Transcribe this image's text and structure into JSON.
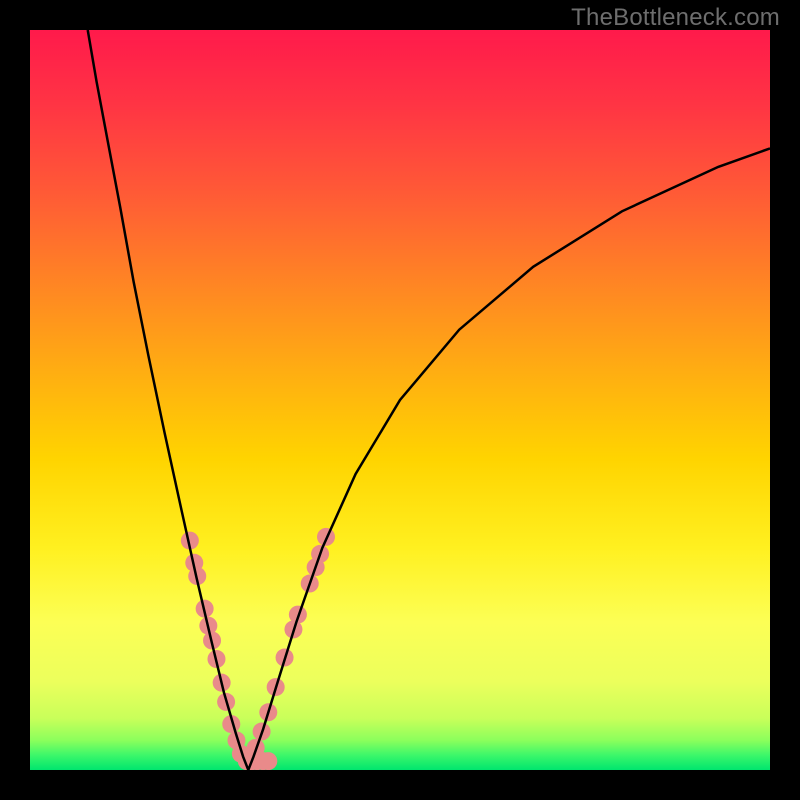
{
  "watermark": "TheBottleneck.com",
  "chart_data": {
    "type": "line",
    "title": "",
    "xlabel": "",
    "ylabel": "",
    "x_range": [
      0,
      1
    ],
    "y_range": [
      0,
      1
    ],
    "background_gradient": {
      "top_color": "#ff1a4b",
      "mid_colors": [
        "#ff6e2a",
        "#ffb200",
        "#ffe100",
        "#fffd55",
        "#d8ff5a",
        "#7dff5e"
      ],
      "bottom_color": "#00e56e"
    },
    "notch_x": 0.295,
    "series": [
      {
        "name": "curve",
        "stroke": "#000000",
        "stroke_width": 2.5,
        "points": [
          {
            "x": 0.078,
            "y": 1.0
          },
          {
            "x": 0.09,
            "y": 0.93
          },
          {
            "x": 0.105,
            "y": 0.85
          },
          {
            "x": 0.122,
            "y": 0.76
          },
          {
            "x": 0.14,
            "y": 0.66
          },
          {
            "x": 0.16,
            "y": 0.56
          },
          {
            "x": 0.182,
            "y": 0.455
          },
          {
            "x": 0.205,
            "y": 0.35
          },
          {
            "x": 0.225,
            "y": 0.26
          },
          {
            "x": 0.245,
            "y": 0.175
          },
          {
            "x": 0.262,
            "y": 0.105
          },
          {
            "x": 0.278,
            "y": 0.05
          },
          {
            "x": 0.288,
            "y": 0.018
          },
          {
            "x": 0.295,
            "y": 0.0
          },
          {
            "x": 0.302,
            "y": 0.018
          },
          {
            "x": 0.315,
            "y": 0.055
          },
          {
            "x": 0.335,
            "y": 0.12
          },
          {
            "x": 0.36,
            "y": 0.2
          },
          {
            "x": 0.395,
            "y": 0.3
          },
          {
            "x": 0.44,
            "y": 0.4
          },
          {
            "x": 0.5,
            "y": 0.5
          },
          {
            "x": 0.58,
            "y": 0.595
          },
          {
            "x": 0.68,
            "y": 0.68
          },
          {
            "x": 0.8,
            "y": 0.755
          },
          {
            "x": 0.93,
            "y": 0.815
          },
          {
            "x": 1.0,
            "y": 0.84
          }
        ]
      }
    ],
    "markers": {
      "fill": "#e98a8a",
      "radius": 9,
      "points": [
        {
          "x": 0.216,
          "y": 0.31
        },
        {
          "x": 0.222,
          "y": 0.28
        },
        {
          "x": 0.226,
          "y": 0.262
        },
        {
          "x": 0.236,
          "y": 0.218
        },
        {
          "x": 0.241,
          "y": 0.195
        },
        {
          "x": 0.246,
          "y": 0.175
        },
        {
          "x": 0.252,
          "y": 0.15
        },
        {
          "x": 0.259,
          "y": 0.118
        },
        {
          "x": 0.265,
          "y": 0.092
        },
        {
          "x": 0.272,
          "y": 0.062
        },
        {
          "x": 0.279,
          "y": 0.04
        },
        {
          "x": 0.285,
          "y": 0.022
        },
        {
          "x": 0.293,
          "y": 0.012
        },
        {
          "x": 0.3,
          "y": 0.012
        },
        {
          "x": 0.307,
          "y": 0.012
        },
        {
          "x": 0.315,
          "y": 0.012
        },
        {
          "x": 0.322,
          "y": 0.012
        },
        {
          "x": 0.305,
          "y": 0.03
        },
        {
          "x": 0.313,
          "y": 0.052
        },
        {
          "x": 0.322,
          "y": 0.078
        },
        {
          "x": 0.332,
          "y": 0.112
        },
        {
          "x": 0.344,
          "y": 0.152
        },
        {
          "x": 0.356,
          "y": 0.19
        },
        {
          "x": 0.362,
          "y": 0.21
        },
        {
          "x": 0.378,
          "y": 0.252
        },
        {
          "x": 0.386,
          "y": 0.274
        },
        {
          "x": 0.392,
          "y": 0.292
        },
        {
          "x": 0.4,
          "y": 0.315
        }
      ]
    }
  }
}
